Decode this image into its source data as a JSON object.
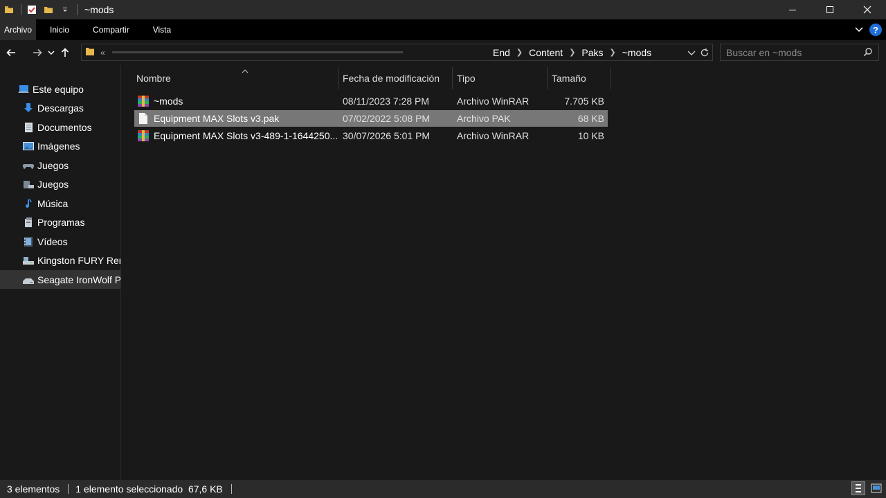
{
  "window": {
    "title": "~mods",
    "minimize": "—",
    "maximize": "☐",
    "close": "✕"
  },
  "ribbon": {
    "tabs": [
      "Archivo",
      "Inicio",
      "Compartir",
      "Vista"
    ]
  },
  "address": {
    "overflow": "«",
    "crumbs": [
      "End",
      "Content",
      "Paks",
      "~mods"
    ]
  },
  "search": {
    "placeholder": "Buscar en ~mods"
  },
  "sidebar": {
    "items": [
      {
        "label": "Este equipo",
        "icon": "computer-icon"
      },
      {
        "label": "Descargas",
        "icon": "downloads-icon"
      },
      {
        "label": "Documentos",
        "icon": "documents-icon"
      },
      {
        "label": "Imágenes",
        "icon": "pictures-icon"
      },
      {
        "label": "Juegos",
        "icon": "gamepad-icon"
      },
      {
        "label": "Juegos",
        "icon": "game-drive-icon"
      },
      {
        "label": "Música",
        "icon": "music-icon"
      },
      {
        "label": "Programas",
        "icon": "programs-icon"
      },
      {
        "label": "Vídeos",
        "icon": "videos-icon"
      },
      {
        "label": "Kingston FURY Renegade",
        "icon": "drive-icon"
      },
      {
        "label": "Seagate IronWolf Pro",
        "icon": "drive-icon"
      }
    ]
  },
  "columns": {
    "name": "Nombre",
    "date": "Fecha de modificación",
    "type": "Tipo",
    "size": "Tamaño"
  },
  "files": [
    {
      "name": "~mods",
      "date": "08/11/2023 7:28 PM",
      "type": "Archivo WinRAR",
      "size": "7.705 KB",
      "icon": "winrar-icon"
    },
    {
      "name": "Equipment MAX Slots v3.pak",
      "date": "07/02/2022 5:08 PM",
      "type": "Archivo PAK",
      "size": "68 KB",
      "icon": "file-icon"
    },
    {
      "name": "Equipment MAX Slots v3-489-1-1644250...",
      "date": "30/07/2026 5:01 PM",
      "type": "Archivo WinRAR",
      "size": "10 KB",
      "icon": "winrar-icon"
    }
  ],
  "status": {
    "count": "3 elementos",
    "selection": "1 elemento seleccionado  67,6 KB"
  },
  "colors": {
    "accent": "#1e6fd9",
    "folder": "#e8b84a",
    "selected_row": "#777777"
  }
}
